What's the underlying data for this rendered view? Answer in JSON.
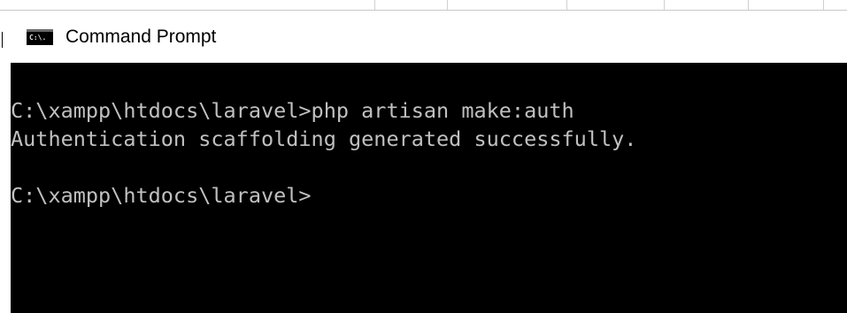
{
  "window": {
    "title": "Command Prompt",
    "icon": "cmd-console-icon",
    "icon_text": "C:\\."
  },
  "console": {
    "background": "#000000",
    "foreground": "#c0c0c0",
    "lines": [
      "C:\\xampp\\htdocs\\laravel>php artisan make:auth",
      "Authentication scaffolding generated successfully.",
      "",
      "C:\\xampp\\htdocs\\laravel>"
    ]
  }
}
